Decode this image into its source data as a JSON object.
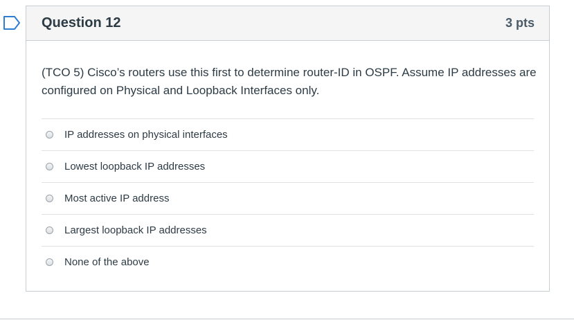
{
  "question": {
    "title": "Question 12",
    "points": "3 pts",
    "text": "(TCO 5) Cisco’s routers use this first to determine router-ID in OSPF. Assume IP addresses are configured on Physical and Loopback Interfaces only.",
    "flag_icon": "bookmark-flag-icon",
    "answers": [
      {
        "label": "IP addresses on physical interfaces",
        "selected": false
      },
      {
        "label": "Lowest loopback IP addresses",
        "selected": false
      },
      {
        "label": "Most active IP address",
        "selected": false
      },
      {
        "label": "Largest loopback IP addresses",
        "selected": false
      },
      {
        "label": "None of the above",
        "selected": false
      }
    ]
  },
  "colors": {
    "flag": "#2d7dd2",
    "border": "#c7cdd1",
    "header_bg": "#f5f5f5",
    "text": "#2d3b45"
  }
}
